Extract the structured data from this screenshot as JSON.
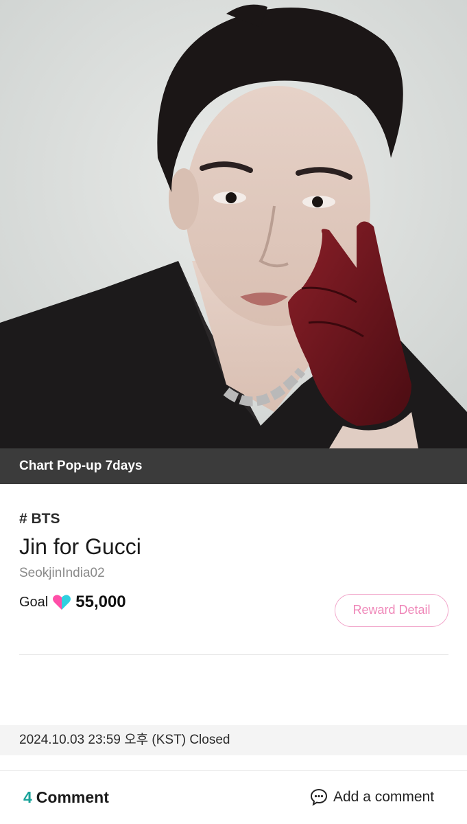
{
  "banner": {
    "label": "Chart Pop-up 7days"
  },
  "project": {
    "tag": "# BTS",
    "title": "Jin for Gucci",
    "author": "SeokjinIndia02",
    "goal_label": "Goal",
    "goal_icon": "heart-icon",
    "goal_value": "55,000",
    "reward_button": "Reward Detail"
  },
  "status": {
    "text": "2024.10.03 23:59 오후 (KST) Closed"
  },
  "comments": {
    "count": "4",
    "label": "Comment",
    "add_label": "Add a comment",
    "add_icon": "chat-bubble-icon"
  },
  "colors": {
    "accent_pink": "#ef86b8",
    "accent_teal": "#1aa39a",
    "banner_bg": "#3b3b3b"
  }
}
